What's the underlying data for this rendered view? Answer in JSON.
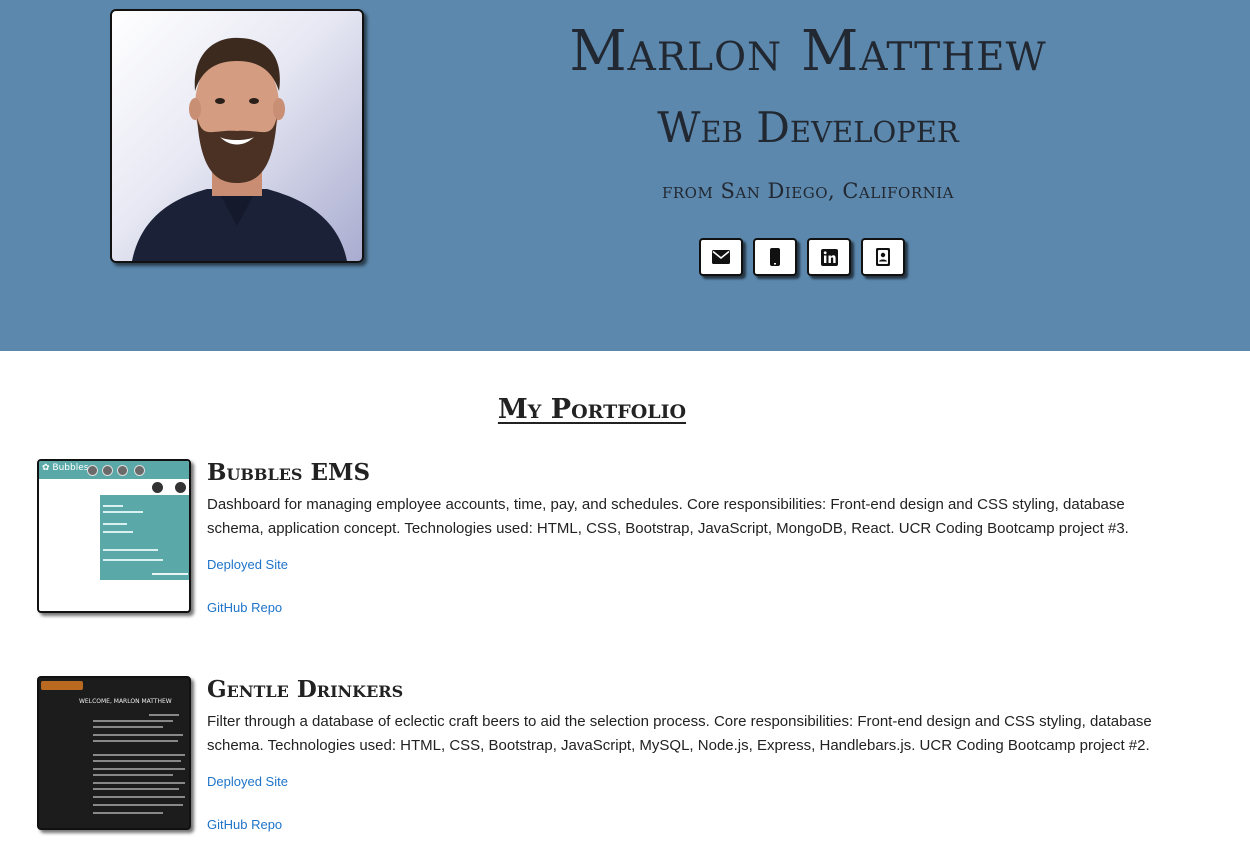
{
  "header": {
    "name": "Marlon Matthew",
    "role": "Web Developer",
    "location": "from San Diego, California",
    "contacts": [
      {
        "icon": "envelope-icon"
      },
      {
        "icon": "mobile-phone-icon"
      },
      {
        "icon": "linkedin-icon"
      },
      {
        "icon": "contact-card-icon"
      }
    ]
  },
  "portfolio": {
    "title": "My Portfolio",
    "projects": [
      {
        "title": "Bubbles EMS",
        "description": "Dashboard for managing employee accounts, time, pay, and schedules. Core responsibilities: Front-end design and CSS styling, database schema, application concept. Technologies used: HTML, CSS, Bootstrap, JavaScript, MongoDB, React. UCR Coding Bootcamp project #3.",
        "deployed_label": "Deployed Site",
        "repo_label": "GitHub Repo"
      },
      {
        "title": "Gentle Drinkers",
        "description": "Filter through a database of eclectic craft beers to aid the selection process. Core responsibilities: Front-end design and CSS styling, database schema. Technologies used: HTML, CSS, Bootstrap, JavaScript, MySQL, Node.js, Express, Handlebars.js. UCR Coding Bootcamp project #2.",
        "deployed_label": "Deployed Site",
        "repo_label": "GitHub Repo"
      }
    ]
  },
  "colors": {
    "hero_bg": "#5c88ad",
    "link": "#1e74c9",
    "text": "#222831"
  }
}
